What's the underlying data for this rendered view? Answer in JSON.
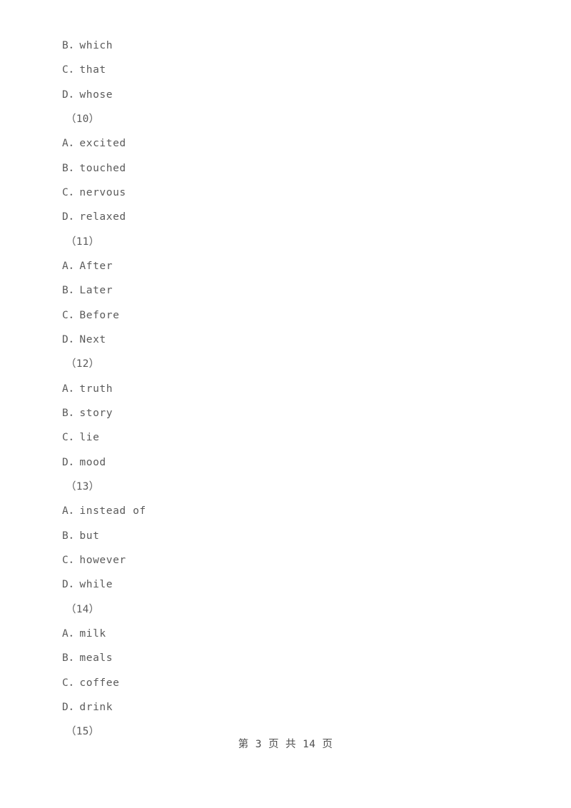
{
  "document": {
    "background_color": "#ffffff",
    "text_color": "#5a5a5a",
    "footer_color": "#4f4f4f"
  },
  "lines": [
    {
      "type": "option",
      "text": "B．which"
    },
    {
      "type": "option",
      "text": "C．that"
    },
    {
      "type": "option",
      "text": "D．whose"
    },
    {
      "type": "qnum",
      "text": "（10）"
    },
    {
      "type": "option",
      "text": "A．excited"
    },
    {
      "type": "option",
      "text": "B．touched"
    },
    {
      "type": "option",
      "text": "C．nervous"
    },
    {
      "type": "option",
      "text": "D．relaxed"
    },
    {
      "type": "qnum",
      "text": "（11）"
    },
    {
      "type": "option",
      "text": "A．After"
    },
    {
      "type": "option",
      "text": "B．Later"
    },
    {
      "type": "option",
      "text": "C．Before"
    },
    {
      "type": "option",
      "text": "D．Next"
    },
    {
      "type": "qnum",
      "text": "（12）"
    },
    {
      "type": "option",
      "text": "A．truth"
    },
    {
      "type": "option",
      "text": "B．story"
    },
    {
      "type": "option",
      "text": "C．lie"
    },
    {
      "type": "option",
      "text": "D．mood"
    },
    {
      "type": "qnum",
      "text": "（13）"
    },
    {
      "type": "option",
      "text": "A．instead of"
    },
    {
      "type": "option",
      "text": "B．but"
    },
    {
      "type": "option",
      "text": "C．however"
    },
    {
      "type": "option",
      "text": "D．while"
    },
    {
      "type": "qnum",
      "text": "（14）"
    },
    {
      "type": "option",
      "text": "A．milk"
    },
    {
      "type": "option",
      "text": "B．meals"
    },
    {
      "type": "option",
      "text": "C．coffee"
    },
    {
      "type": "option",
      "text": "D．drink"
    },
    {
      "type": "qnum",
      "text": "（15）"
    }
  ],
  "footer": {
    "text": "第 3 页 共 14 页",
    "current_page": "3",
    "total_pages": "14"
  }
}
